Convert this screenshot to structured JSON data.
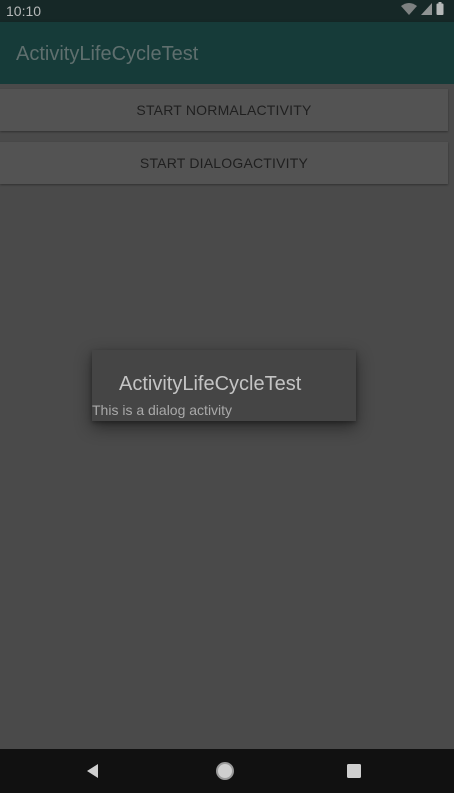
{
  "status_bar": {
    "time": "10:10",
    "icons": [
      "wifi-icon",
      "signal-icon",
      "battery-icon"
    ]
  },
  "app_bar": {
    "title": "ActivityLifeCycleTest"
  },
  "buttons": {
    "start_normal": "START NORMALACTIVITY",
    "start_dialog": "START DIALOGACTIVITY"
  },
  "dialog": {
    "title": "ActivityLifeCycleTest",
    "message": "This is a dialog activity"
  },
  "nav_bar": {
    "icons": [
      "back-icon",
      "home-icon",
      "recents-icon"
    ]
  },
  "colors": {
    "status_bar": "#162827",
    "app_bar": "#163b39",
    "background": "#4a4a4a",
    "dialog": "#454545",
    "nav_bar": "#111111"
  }
}
